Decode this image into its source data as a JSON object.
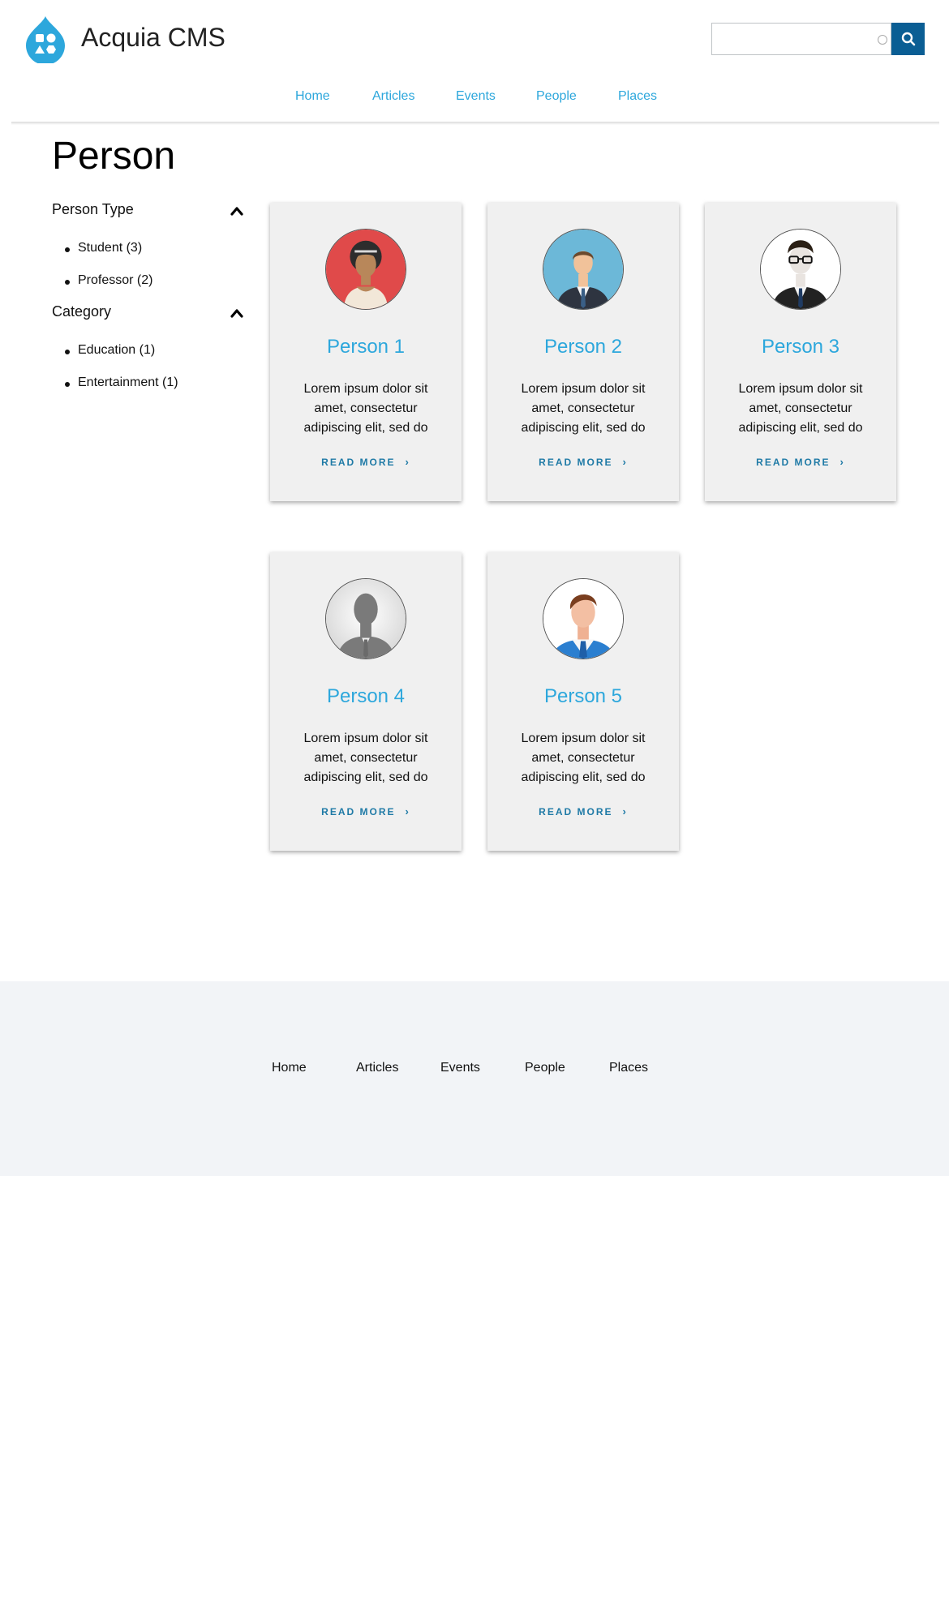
{
  "site": {
    "name": "Acquia CMS",
    "search_placeholder": ""
  },
  "main_nav": [
    "Home",
    "Articles",
    "Events",
    "People",
    "Places"
  ],
  "page_title": "Person",
  "facets": [
    {
      "label": "Person Type",
      "items": [
        "Student (3)",
        "Professor (2)"
      ]
    },
    {
      "label": "Category",
      "items": [
        "Education (1)",
        "Entertainment (1)"
      ]
    }
  ],
  "cards": [
    {
      "title": "Person 1",
      "text": "Lorem ipsum dolor sit amet, consectetur adipiscing elit, sed do",
      "link": "READ MORE",
      "avatar": "woman-avatar-icon"
    },
    {
      "title": "Person 2",
      "text": "Lorem ipsum dolor sit amet, consectetur adipiscing elit, sed do",
      "link": "READ MORE",
      "avatar": "businessman-avatar-icon"
    },
    {
      "title": "Person 3",
      "text": "Lorem ipsum dolor sit amet, consectetur adipiscing elit, sed do",
      "link": "READ MORE",
      "avatar": "glasses-man-avatar-icon"
    },
    {
      "title": "Person 4",
      "text": "Lorem ipsum dolor sit amet, consectetur adipiscing elit, sed do",
      "link": "READ MORE",
      "avatar": "silhouette-avatar-icon"
    },
    {
      "title": "Person 5",
      "text": "Lorem ipsum dolor sit amet, consectetur adipiscing elit, sed do",
      "link": "READ MORE",
      "avatar": "man-avatar-icon"
    }
  ],
  "footer_nav": [
    "Home",
    "Articles",
    "Events",
    "People",
    "Places"
  ],
  "colors": {
    "accent": "#2da7dc",
    "search_button": "#0a5e94",
    "card_bg": "#f0f0f0",
    "footer_bg": "#f2f4f7"
  }
}
